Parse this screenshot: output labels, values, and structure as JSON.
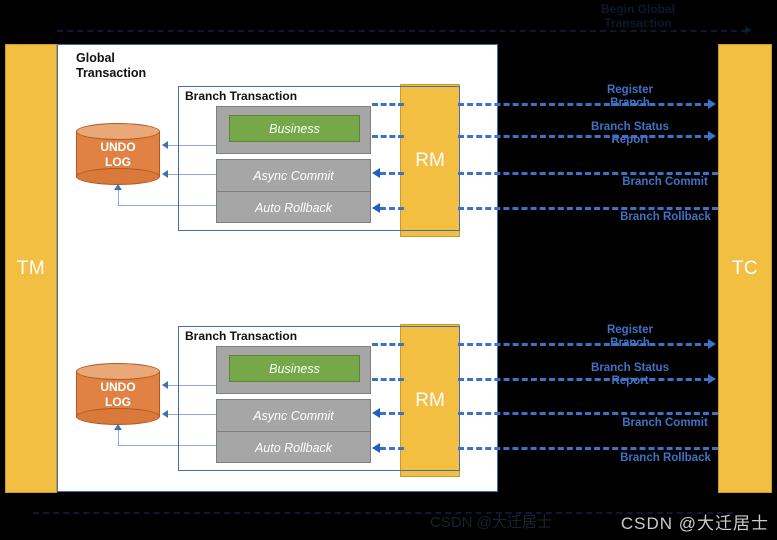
{
  "diagram": {
    "header": {
      "title": "Begin Global\nTransaction"
    },
    "actors": {
      "tm": "TM",
      "tc": "TC",
      "rm": "RM"
    },
    "canvas": {
      "global_title": "Global\nTransaction"
    },
    "branches": [
      {
        "title": "Branch Transaction",
        "business_label": "Business",
        "async_commit_label": "Async Commit",
        "auto_rollback_label": "Auto Rollback",
        "undo_log_label": "UNDO\nLOG",
        "rm_label": "RM",
        "messages": [
          {
            "label": "Register\nBranch",
            "direction": "right"
          },
          {
            "label": "Branch Status\nReport",
            "direction": "right"
          },
          {
            "label": "Branch Commit",
            "direction": "left"
          },
          {
            "label": "Branch Rollback",
            "direction": "left"
          }
        ]
      },
      {
        "title": "Branch Transaction",
        "business_label": "Business",
        "async_commit_label": "Async Commit",
        "auto_rollback_label": "Auto Rollback",
        "undo_log_label": "UNDO\nLOG",
        "rm_label": "RM",
        "messages": [
          {
            "label": "Register\nBranch",
            "direction": "right"
          },
          {
            "label": "Branch Status\nReport",
            "direction": "right"
          },
          {
            "label": "Branch Commit",
            "direction": "left"
          },
          {
            "label": "Branch Rollback",
            "direction": "left"
          }
        ]
      }
    ],
    "watermark": "CSDN @大迁居士",
    "watermark_faint": "CSDN @大迁居士",
    "colors": {
      "actor_fill": "#f2bf43",
      "actor_border": "#c99a2e",
      "panel_grey": "#a6a6a6",
      "business_green": "#76a84a",
      "undo_orange": "#e08244",
      "message_blue": "#3f72c4",
      "canvas_border": "#4472a8",
      "background": "#000000"
    }
  }
}
